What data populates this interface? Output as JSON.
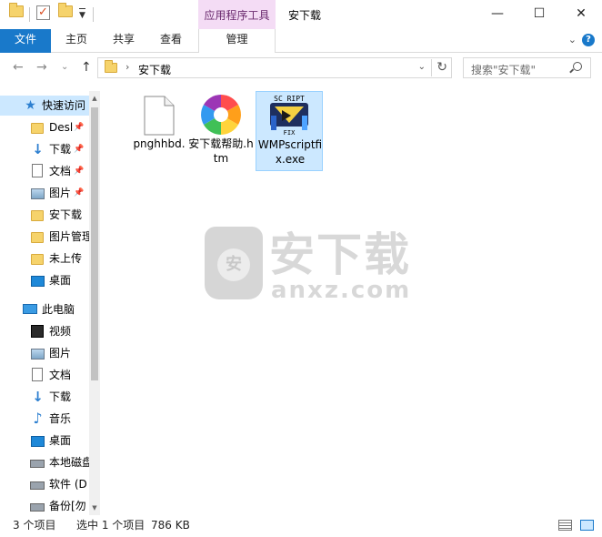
{
  "window": {
    "title": "安下载",
    "context_tab_group": "应用程序工具",
    "minimize": "—",
    "maximize": "☐",
    "close": "✕"
  },
  "ribbon": {
    "tabs": [
      "文件",
      "主页",
      "共享",
      "查看",
      "管理"
    ],
    "expand_glyph": "⌄",
    "help_glyph": "?"
  },
  "nav": {
    "back": "←",
    "forward": "→",
    "recent": "⌄",
    "up": "↑",
    "address_sep": "›",
    "address_path": "安下载",
    "address_dropdown": "⌄",
    "refresh": "↻",
    "search_placeholder": "搜索\"安下载\""
  },
  "sidebar": {
    "items": [
      {
        "label": "快速访问",
        "icon": "star-icon"
      },
      {
        "label": "Desl",
        "icon": "folder-icon",
        "pinned": "📌"
      },
      {
        "label": "下载",
        "icon": "download-icon",
        "pinned": "📌"
      },
      {
        "label": "文档",
        "icon": "document-icon",
        "pinned": "📌"
      },
      {
        "label": "图片",
        "icon": "picture-icon",
        "pinned": "📌"
      },
      {
        "label": "安下载",
        "icon": "folder-icon"
      },
      {
        "label": "图片管理",
        "icon": "folder-icon"
      },
      {
        "label": "未上传",
        "icon": "folder-icon"
      },
      {
        "label": "桌面",
        "icon": "desktop-icon"
      },
      {
        "label": "此电脑",
        "icon": "computer-icon"
      },
      {
        "label": "视频",
        "icon": "video-icon"
      },
      {
        "label": "图片",
        "icon": "picture-icon"
      },
      {
        "label": "文档",
        "icon": "document-icon"
      },
      {
        "label": "下载",
        "icon": "download-icon"
      },
      {
        "label": "音乐",
        "icon": "music-icon"
      },
      {
        "label": "桌面",
        "icon": "desktop-icon"
      },
      {
        "label": "本地磁盘",
        "icon": "disk-icon"
      },
      {
        "label": "软件 (D",
        "icon": "disk-icon"
      },
      {
        "label": "备份[勿",
        "icon": "disk-icon"
      }
    ],
    "scroll_up": "▲",
    "scroll_down": "▼"
  },
  "files": [
    {
      "name": "pnghhbd.",
      "icon": "blank-file-icon"
    },
    {
      "name": "安下载帮助.htm",
      "icon": "browser-pinwheel-icon"
    },
    {
      "name": "WMPscriptfix.exe",
      "icon": "script-fix-app-icon",
      "selected": true
    }
  ],
  "watermark": {
    "shield_glyph": "安",
    "cn": "安下载",
    "en": "anxz.com"
  },
  "status": {
    "count": "3 个项目",
    "selected": "选中 1 个项目",
    "size": "786 KB"
  },
  "colors": {
    "accent": "#1979ca",
    "selection": "#cce8ff",
    "context_tab": "#f4dcf5"
  }
}
